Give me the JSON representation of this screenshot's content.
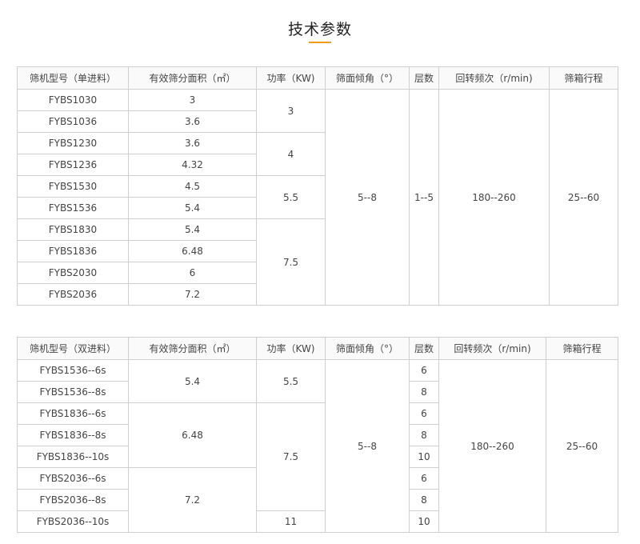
{
  "page": {
    "title": "技术参数"
  },
  "table1": {
    "headers": [
      "筛机型号（单进料）",
      "有效筛分面积（㎡）",
      "功率（KW)",
      "筛面倾角（°）",
      "层数",
      "回转频次（r/min)",
      "筛箱行程"
    ],
    "models": [
      "FYBS1030",
      "FYBS1036",
      "FYBS1230",
      "FYBS1236",
      "FYBS1530",
      "FYBS1536",
      "FYBS1830",
      "FYBS1836",
      "FYBS2030",
      "FYBS2036"
    ],
    "areas": [
      "3",
      "3.6",
      "3.6",
      "4.32",
      "4.5",
      "5.4",
      "5.4",
      "6.48",
      "6",
      "7.2"
    ],
    "powers": [
      "3",
      "4",
      "5.5",
      "7.5"
    ],
    "angle": "5--8",
    "layers": "1--5",
    "frequency": "180--260",
    "stroke": "25--60"
  },
  "table2": {
    "headers": [
      "筛机型号（双进料）",
      "有效筛分面积（㎡）",
      "功率（KW)",
      "筛面倾角（°）",
      "层数",
      "回转频次（r/min)",
      "筛箱行程"
    ],
    "models": [
      "FYBS1536--6s",
      "FYBS1536--8s",
      "FYBS1836--6s",
      "FYBS1836--8s",
      "FYBS1836--10s",
      "FYBS2036--6s",
      "FYBS2036--8s",
      "FYBS2036--10s"
    ],
    "areas": [
      "5.4",
      "6.48",
      "7.2"
    ],
    "powers": [
      "5.5",
      "7.5",
      "11"
    ],
    "angle": "5--8",
    "layers": [
      "6",
      "8",
      "6",
      "8",
      "10",
      "6",
      "8",
      "10"
    ],
    "frequency": "180--260",
    "stroke": "25--60"
  }
}
